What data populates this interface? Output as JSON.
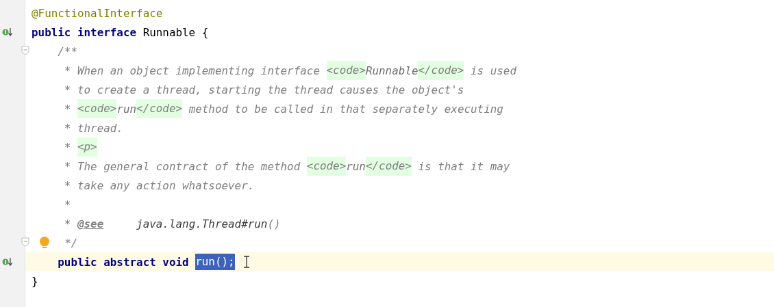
{
  "editor": {
    "lines": [
      {
        "current": false,
        "tokens": [
          {
            "kind": "annotation",
            "text": "@FunctionalInterface"
          }
        ]
      },
      {
        "current": false,
        "gutter_icons": [
          {
            "kind": "implemented"
          }
        ],
        "tokens": [
          {
            "kind": "keyword",
            "text": "public interface"
          },
          {
            "kind": "plain",
            "text": " Runnable {"
          }
        ]
      },
      {
        "current": false,
        "gutter_icons": [
          {
            "kind": "fold"
          }
        ],
        "tokens": [
          {
            "kind": "comment",
            "text": "    /**"
          }
        ]
      },
      {
        "current": false,
        "tokens": [
          {
            "kind": "comment",
            "text": "     * When an object implementing interface "
          },
          {
            "kind": "tag",
            "text": "<code>"
          },
          {
            "kind": "tag-text",
            "text": "Runnable"
          },
          {
            "kind": "tag",
            "text": "</code>"
          },
          {
            "kind": "comment",
            "text": " is used"
          }
        ]
      },
      {
        "current": false,
        "tokens": [
          {
            "kind": "comment",
            "text": "     * to create a thread, starting the thread causes the object's"
          }
        ]
      },
      {
        "current": false,
        "tokens": [
          {
            "kind": "comment",
            "text": "     * "
          },
          {
            "kind": "tag",
            "text": "<code>"
          },
          {
            "kind": "tag-text",
            "text": "run"
          },
          {
            "kind": "tag",
            "text": "</code>"
          },
          {
            "kind": "comment",
            "text": " method to be called in that separately executing"
          }
        ]
      },
      {
        "current": false,
        "tokens": [
          {
            "kind": "comment",
            "text": "     * thread."
          }
        ]
      },
      {
        "current": false,
        "tokens": [
          {
            "kind": "comment",
            "text": "     * "
          },
          {
            "kind": "tag",
            "text": "<p>"
          }
        ]
      },
      {
        "current": false,
        "tokens": [
          {
            "kind": "comment",
            "text": "     * The general contract of the method "
          },
          {
            "kind": "tag",
            "text": "<code>"
          },
          {
            "kind": "tag-text",
            "text": "run"
          },
          {
            "kind": "tag",
            "text": "</code>"
          },
          {
            "kind": "comment",
            "text": " is that it may"
          }
        ]
      },
      {
        "current": false,
        "tokens": [
          {
            "kind": "comment",
            "text": "     * take any action whatsoever."
          }
        ]
      },
      {
        "current": false,
        "tokens": [
          {
            "kind": "comment",
            "text": "     *"
          }
        ]
      },
      {
        "current": false,
        "tokens": [
          {
            "kind": "comment",
            "text": "     * "
          },
          {
            "kind": "doc-tag",
            "text": "@see"
          },
          {
            "kind": "doc-ref",
            "text": "     java.lang.Thread#run"
          },
          {
            "kind": "comment",
            "text": "()"
          }
        ]
      },
      {
        "current": false,
        "gutter_icons": [
          {
            "kind": "fold"
          }
        ],
        "bulb": true,
        "tokens": [
          {
            "kind": "comment",
            "text": "  */"
          }
        ]
      },
      {
        "current": true,
        "gutter_icons": [
          {
            "kind": "implemented"
          }
        ],
        "caret": true,
        "tokens": [
          {
            "kind": "keyword",
            "text": "    public abstract void "
          },
          {
            "kind": "selection",
            "text": "run();"
          }
        ]
      },
      {
        "current": false,
        "tokens": [
          {
            "kind": "plain",
            "text": "}"
          }
        ]
      }
    ]
  }
}
